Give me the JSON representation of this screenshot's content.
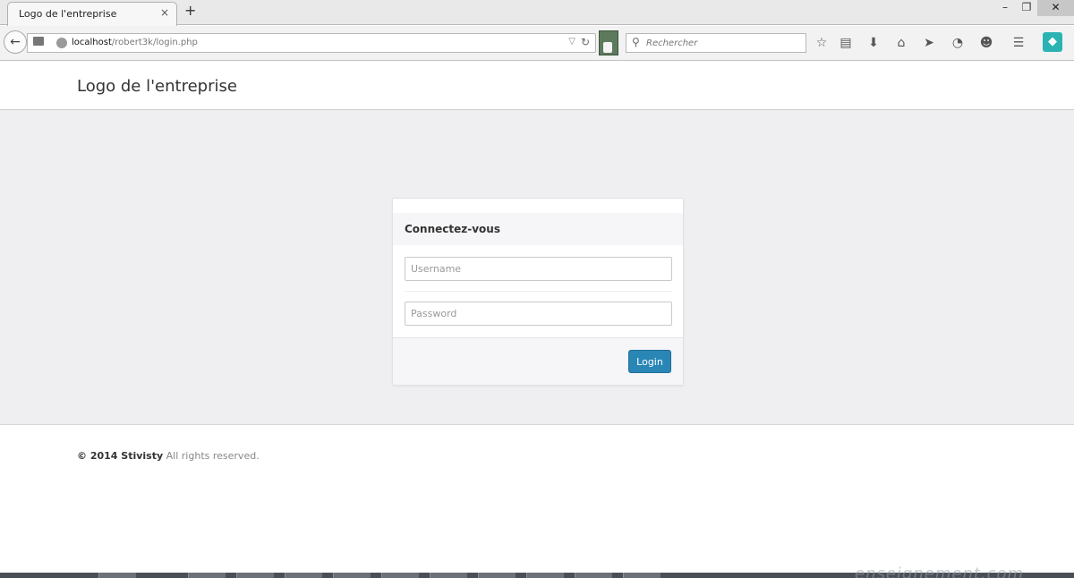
{
  "browser": {
    "tab_title": "Logo de l'entreprise",
    "tab_close_glyph": "×",
    "new_tab_glyph": "+",
    "window_buttons": {
      "minimize": "–",
      "maximize": "❐",
      "close": "✕"
    },
    "url_host": "localhost",
    "url_path": "/robert3k/login.php",
    "search_placeholder": "Rechercher",
    "toolbar_icons": [
      "star-icon",
      "bookmarks-icon",
      "download-icon",
      "home-icon",
      "send-icon",
      "history-icon",
      "chat-icon",
      "menu-icon",
      "pocket-icon"
    ]
  },
  "site": {
    "logo_text": "Logo de l'entreprise"
  },
  "login": {
    "title": "Connectez-vous",
    "username_placeholder": "Username",
    "password_placeholder": "Password",
    "submit_label": "Login",
    "accent_color": "#2a86b5"
  },
  "footer": {
    "brand": "© 2014 Stivisty",
    "rest": " All rights reserved."
  },
  "watermark": {
    "text": "enseignement.com"
  }
}
